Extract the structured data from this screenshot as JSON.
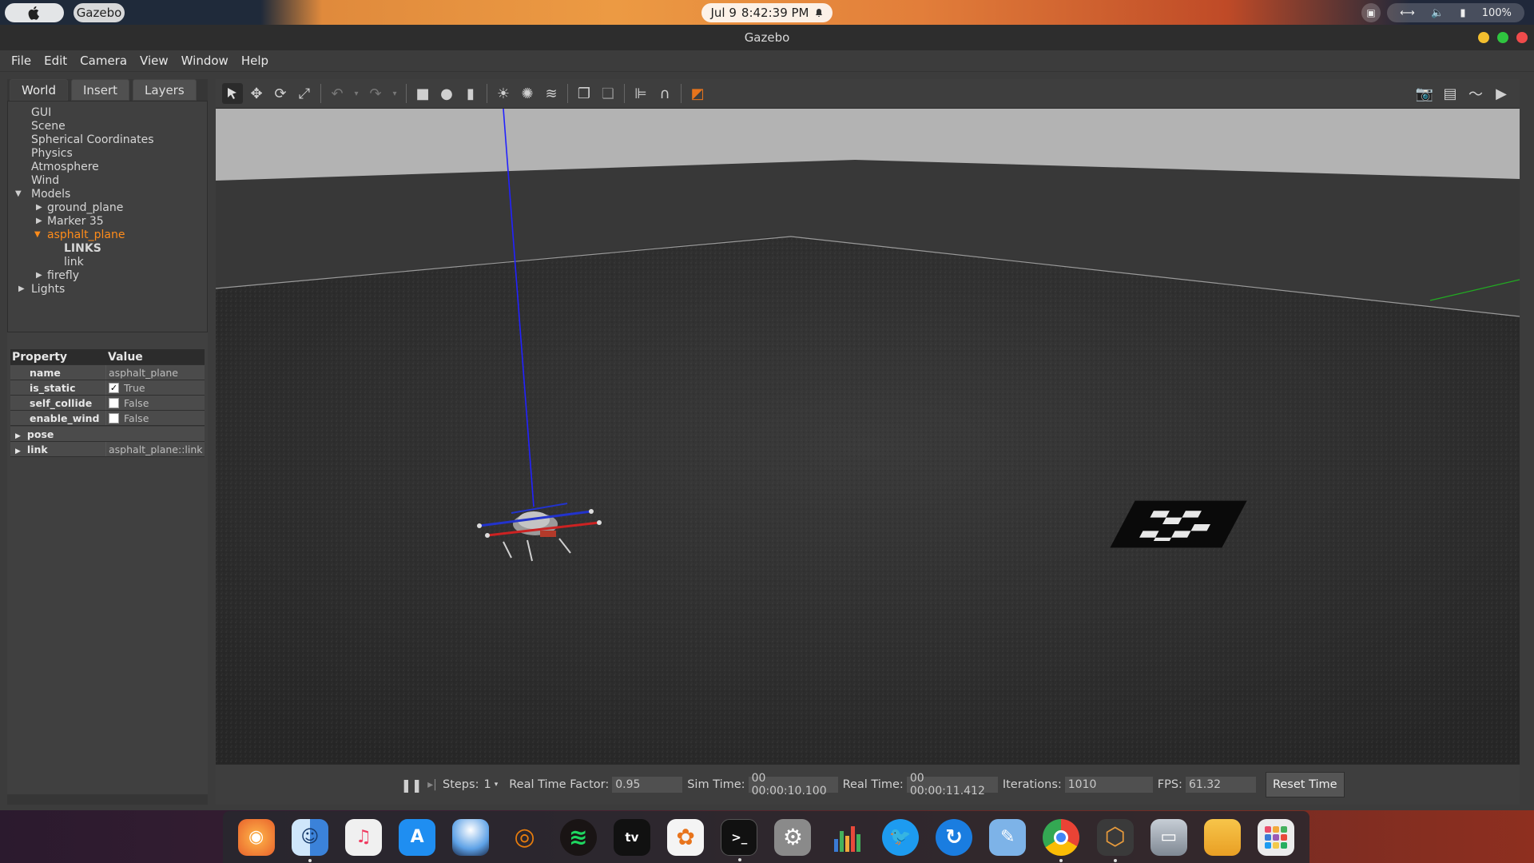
{
  "system_bar": {
    "apple_glyph": "",
    "app_name": "Gazebo",
    "date": "Jul 9",
    "time": "8:42:39 PM",
    "battery": "100%"
  },
  "window": {
    "title": "Gazebo",
    "controls": {
      "minimize_color": "#f4bf2e",
      "maximize_color": "#2fc53f",
      "close_color": "#f04b4b"
    }
  },
  "menu": [
    {
      "label": "File"
    },
    {
      "label": "Edit"
    },
    {
      "label": "Camera"
    },
    {
      "label": "View"
    },
    {
      "label": "Window"
    },
    {
      "label": "Help"
    }
  ],
  "left_tabs": [
    {
      "label": "World"
    },
    {
      "label": "Insert"
    },
    {
      "label": "Layers"
    }
  ],
  "tree": {
    "gui": "GUI",
    "scene": "Scene",
    "spherical": "Spherical Coordinates",
    "physics": "Physics",
    "atmosphere": "Atmosphere",
    "wind": "Wind",
    "models": "Models",
    "ground_plane": "ground_plane",
    "marker": "Marker 35",
    "asphalt_plane": "asphalt_plane",
    "links": "LINKS",
    "link": "link",
    "firefly": "firefly",
    "lights": "Lights"
  },
  "props": {
    "header_property": "Property",
    "header_value": "Value",
    "rows": [
      {
        "name": "name",
        "value": "asphalt_plane"
      },
      {
        "name": "is_static",
        "value": "True",
        "checked": "✓"
      },
      {
        "name": "self_collide",
        "value": "False"
      },
      {
        "name": "enable_wind",
        "value": "False"
      }
    ],
    "pose": "pose",
    "link": "link",
    "link_value": "asphalt_plane::link"
  },
  "bottom": {
    "steps_label": "Steps:",
    "steps_value": "1",
    "rtf_label": "Real Time Factor:",
    "rtf_value": "0.95",
    "sim_label": "Sim Time:",
    "sim_value": "00 00:00:10.100",
    "real_label": "Real Time:",
    "real_value": "00 00:00:11.412",
    "iter_label": "Iterations:",
    "iter_value": "1010",
    "fps_label": "FPS:",
    "fps_value": "61.32",
    "reset_label": "Reset Time"
  },
  "dock": [
    {
      "name": "firefox-icon",
      "color": "#e8612b"
    },
    {
      "name": "finder-icon",
      "color": "#3b82d9"
    },
    {
      "name": "music-icon",
      "color": "#f0f0f0"
    },
    {
      "name": "app-store-icon",
      "color": "#1f8ef1"
    },
    {
      "name": "macos-icon",
      "color": "#5da1e6"
    },
    {
      "name": "blender-icon",
      "color": "#e87d0d"
    },
    {
      "name": "spotify-icon",
      "color": "#1ed760"
    },
    {
      "name": "apple-tv-icon",
      "color": "#111111"
    },
    {
      "name": "photos-icon",
      "color": "#f4f4f4"
    },
    {
      "name": "terminal-icon",
      "color": "#111111"
    },
    {
      "name": "system-prefs-icon",
      "color": "#8a8a8a"
    },
    {
      "name": "charts-icon",
      "color": "#ffffff"
    },
    {
      "name": "twitter-icon",
      "color": "#1d9bf0"
    },
    {
      "name": "sync-icon",
      "color": "#1a7de0"
    },
    {
      "name": "preview-icon",
      "color": "#7db3e8"
    },
    {
      "name": "chrome-icon",
      "color": "#4285f4"
    },
    {
      "name": "gazebo-icon",
      "color": "#e89b3c"
    },
    {
      "name": "drive-icon",
      "color": "#9aa3ad"
    },
    {
      "name": "folder-icon",
      "color": "#f2b53a"
    },
    {
      "name": "launchpad-icon",
      "color": "#e94e6b"
    }
  ]
}
